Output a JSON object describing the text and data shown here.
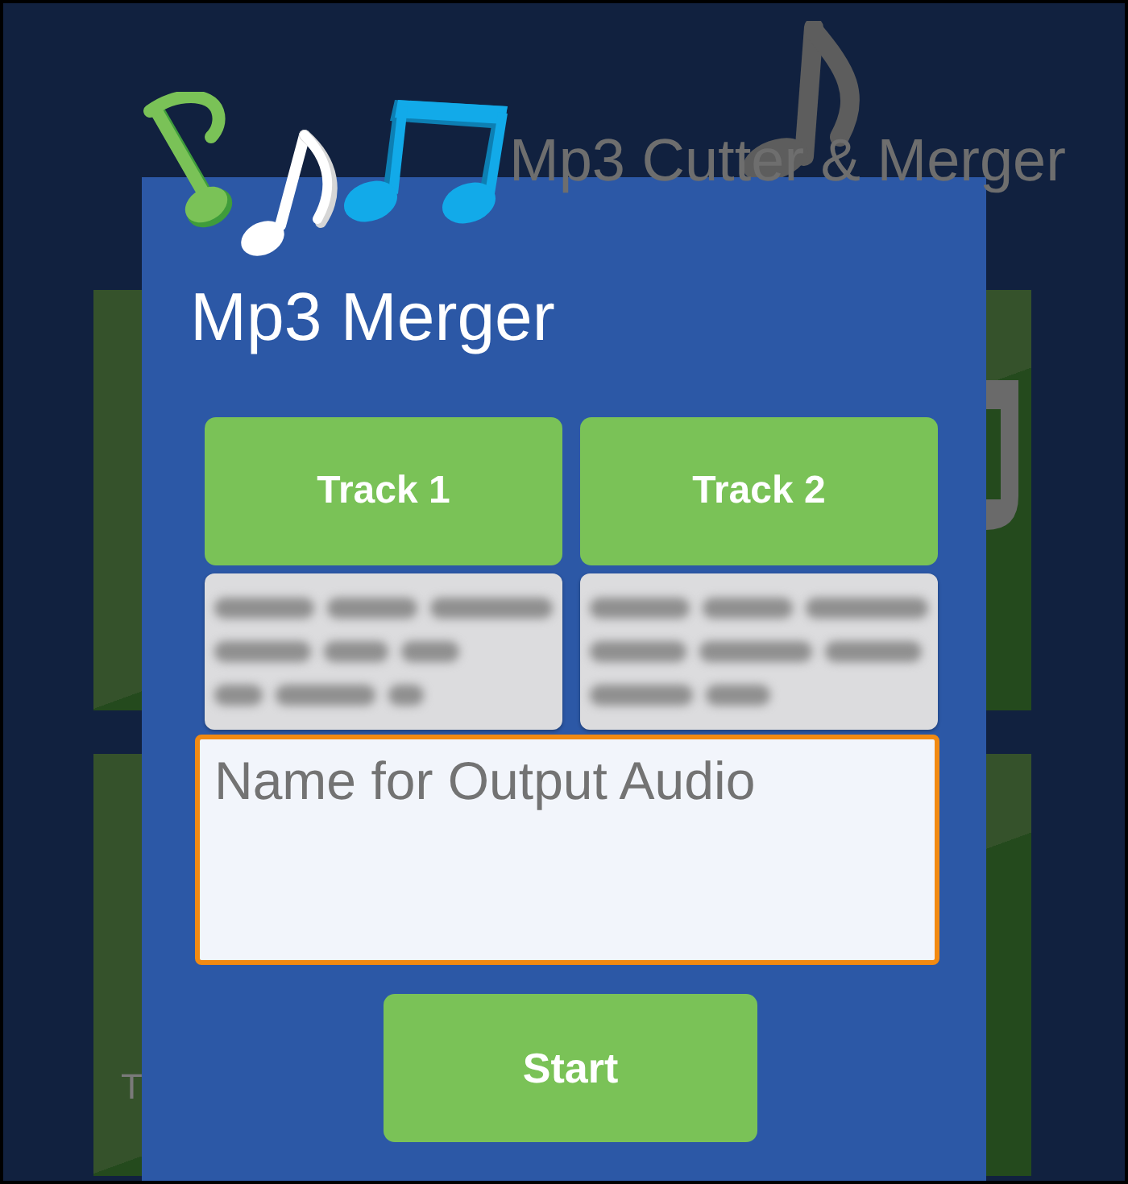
{
  "background": {
    "app_title": "Mp3 Cutter & Merger",
    "card_text": "T"
  },
  "dialog": {
    "title": "Mp3 Merger",
    "tracks": [
      {
        "label": "Track 1"
      },
      {
        "label": "Track 2"
      }
    ],
    "output_name": {
      "placeholder": "Name for Output Audio",
      "focused": true
    },
    "start_button": "Start"
  }
}
